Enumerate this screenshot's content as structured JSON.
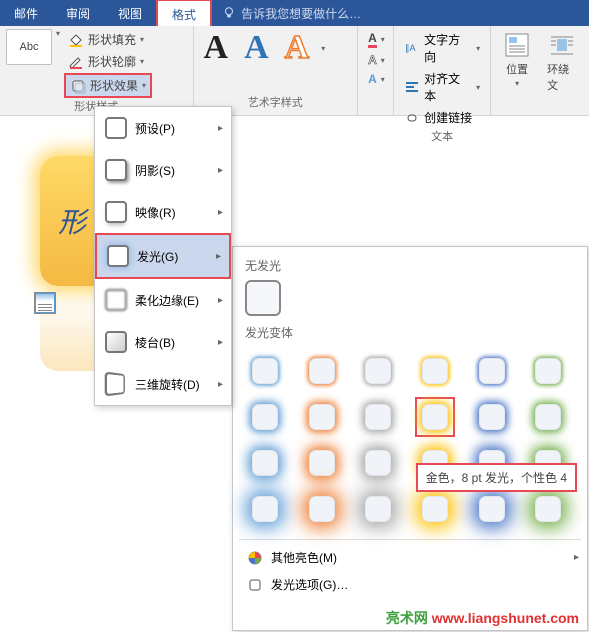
{
  "tabs": {
    "mail": "邮件",
    "review": "审阅",
    "view": "视图",
    "format": "格式",
    "tell_me": "告诉我您想要做什么…"
  },
  "ribbon": {
    "shape_styles_label": "形状样式",
    "abc": "Abc",
    "shape_fill": "形状填充",
    "shape_outline": "形状轮廓",
    "shape_effects": "形状效果",
    "wordart_label": "艺术字样式",
    "text_group": {
      "direction": "文字方向",
      "align": "对齐文本",
      "link": "创建链接",
      "label": "文本"
    },
    "position": "位置",
    "wrap": "环绕文"
  },
  "shape_text": "形",
  "effects_menu": {
    "preset": "预设(P)",
    "shadow": "阴影(S)",
    "reflection": "映像(R)",
    "glow": "发光(G)",
    "soft_edges": "柔化边缘(E)",
    "bevel": "棱台(B)",
    "rotation3d": "三维旋转(D)"
  },
  "glow_panel": {
    "no_glow": "无发光",
    "variants": "发光变体",
    "more_colors": "其他亮色(M)",
    "glow_options": "发光选项(G)…",
    "tooltip": "金色，8 pt 发光，个性色 4",
    "colors": [
      "#5b9bd5",
      "#ed7d31",
      "#a5a5a5",
      "#ffc000",
      "#4472c4",
      "#70ad47"
    ],
    "rows": 4
  },
  "watermark": {
    "a": "亮术网",
    "b": "www.liangshunet.com"
  }
}
